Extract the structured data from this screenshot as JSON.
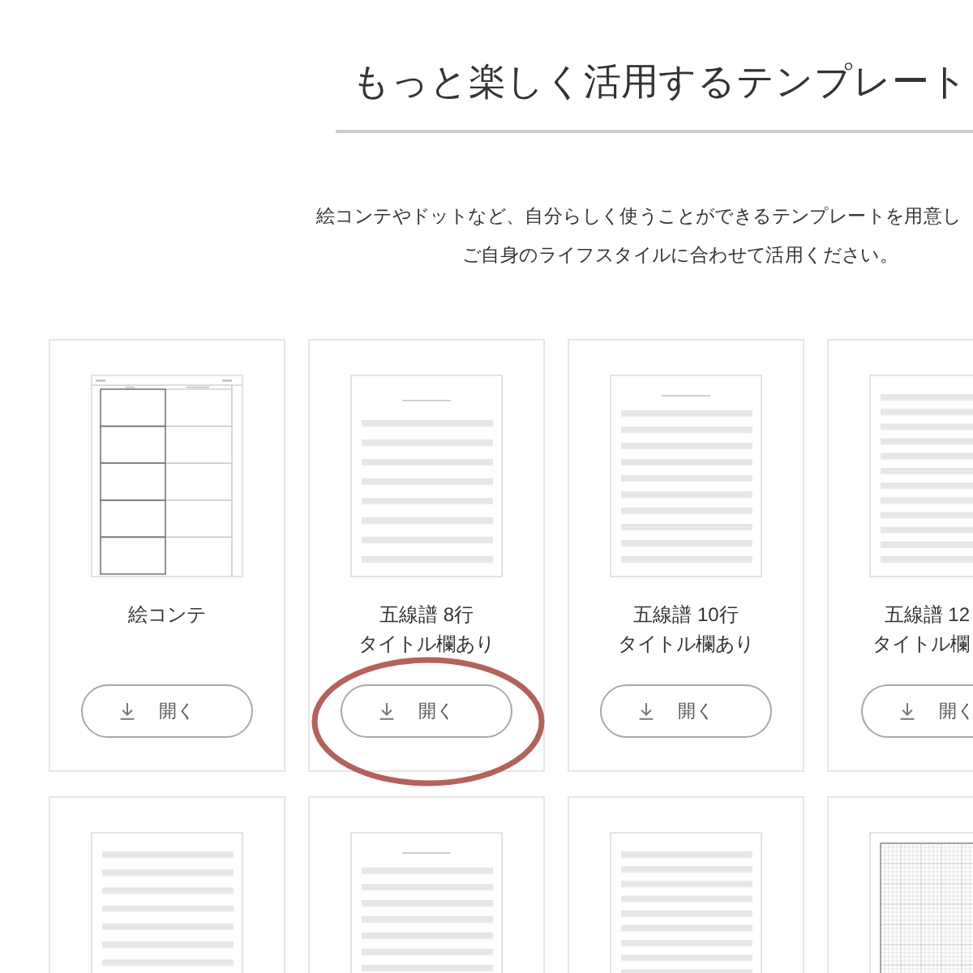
{
  "heading": {
    "title": "もっと楽しく活用するテンプレート"
  },
  "intro": [
    "絵コンテやドットなど、自分らしく使うことができるテンプレートを用意し",
    "ご自身のライフスタイルに合わせて活用ください。"
  ],
  "cards": [
    {
      "kind": "storyboard",
      "name": "絵コンテ",
      "button": "開く",
      "highlighted": false
    },
    {
      "kind": "staff8",
      "titled": true,
      "name": "五線譜 8行",
      "note": "タイトル欄あり",
      "button": "開く",
      "highlighted": true
    },
    {
      "kind": "staff10",
      "titled": true,
      "name": "五線譜 10行",
      "note": "タイトル欄あり",
      "button": "開く",
      "highlighted": false
    },
    {
      "kind": "staff12",
      "titled": false,
      "name": "五線譜 12",
      "note": "タイトル欄",
      "button": "開く",
      "highlighted": false
    },
    {
      "kind": "staff10",
      "titled": false,
      "highlighted": false
    },
    {
      "kind": "staff10",
      "titled": true,
      "highlighted": false
    },
    {
      "kind": "staff12",
      "titled": false,
      "highlighted": false
    },
    {
      "kind": "grid",
      "highlighted": false
    }
  ]
}
